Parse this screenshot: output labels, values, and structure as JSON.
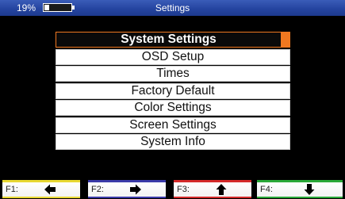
{
  "status_bar": {
    "battery_percent_text": "19%",
    "battery_level": 0.19,
    "title": "Settings"
  },
  "menu": {
    "items": [
      {
        "label": "System Settings",
        "selected": true
      },
      {
        "label": "OSD Setup",
        "selected": false
      },
      {
        "label": "Times",
        "selected": false
      },
      {
        "label": "Factory Default",
        "selected": false
      },
      {
        "label": "Color Settings",
        "selected": false
      },
      {
        "label": "Screen Settings",
        "selected": false
      },
      {
        "label": "System Info",
        "selected": false
      }
    ],
    "selection_color": "#f07820"
  },
  "function_keys": [
    {
      "label": "F1:",
      "icon": "arrow-left-icon",
      "color": "#e8d832"
    },
    {
      "label": "F2:",
      "icon": "arrow-right-icon",
      "color": "#3a3aa8"
    },
    {
      "label": "F3:",
      "icon": "arrow-up-icon",
      "color": "#d42a2a"
    },
    {
      "label": "F4:",
      "icon": "arrow-down-icon",
      "color": "#2aa838"
    }
  ]
}
